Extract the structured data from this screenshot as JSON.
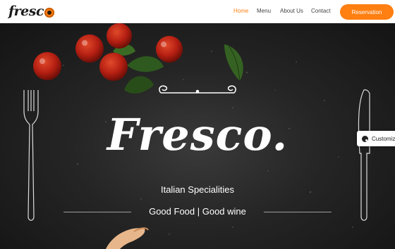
{
  "brand": {
    "logo_text": "fresc",
    "logo_icon": "orange-o-logo-icon"
  },
  "nav": {
    "links": [
      {
        "label": "Home",
        "active": true
      },
      {
        "label": "Menu",
        "active": false
      },
      {
        "label": "About Us",
        "active": false
      },
      {
        "label": "Contact",
        "active": false
      }
    ],
    "reservation_label": "Reservation"
  },
  "hero": {
    "title": "Fresco.",
    "subtitle": "Italian Specialities",
    "tagline": "Good Food | Good wine"
  },
  "customize": {
    "label": "Customize",
    "icon": "palette-icon"
  },
  "colors": {
    "accent": "#ff7f11",
    "hero_bg": "#1c1c1c",
    "nav_bg": "#ffffff"
  }
}
